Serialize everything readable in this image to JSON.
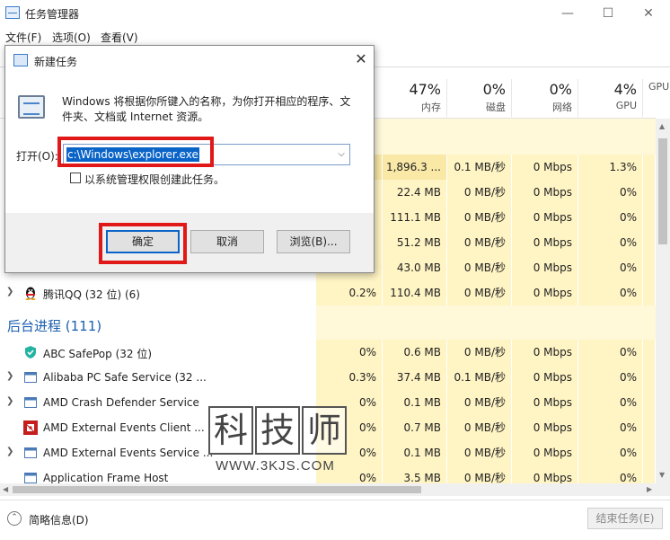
{
  "window": {
    "title": "任务管理器"
  },
  "menu": [
    "文件(F)",
    "选项(O)",
    "查看(V)"
  ],
  "columns": [
    {
      "pct": "47%",
      "label": "内存"
    },
    {
      "pct": "0%",
      "label": "磁盘"
    },
    {
      "pct": "0%",
      "label": "网络"
    },
    {
      "pct": "4%",
      "label": "GPU"
    },
    {
      "pct": "",
      "label": "GPU"
    }
  ],
  "app_rows": [
    {
      "cpu": "",
      "mem": "1,896.3 ...",
      "disk": "0.1 MB/秒",
      "net": "0 Mbps",
      "gpu": "1.3%"
    },
    {
      "cpu": "",
      "mem": "22.4 MB",
      "disk": "0 MB/秒",
      "net": "0 Mbps",
      "gpu": "0%"
    },
    {
      "cpu": "",
      "mem": "111.1 MB",
      "disk": "0 MB/秒",
      "net": "0 Mbps",
      "gpu": "0%"
    },
    {
      "cpu": "",
      "mem": "51.2 MB",
      "disk": "0 MB/秒",
      "net": "0 Mbps",
      "gpu": "0%"
    },
    {
      "cpu": "",
      "mem": "43.0 MB",
      "disk": "0 MB/秒",
      "net": "0 Mbps",
      "gpu": "0%"
    },
    {
      "name": "腾讯QQ (32 位) (6)",
      "cpu": "0.2%",
      "mem": "110.4 MB",
      "disk": "0 MB/秒",
      "net": "0 Mbps",
      "gpu": "0%"
    }
  ],
  "background_section": {
    "title": "后台进程 (111)"
  },
  "bg_rows": [
    {
      "name": "ABC SafePop (32 位)",
      "cpu": "0%",
      "mem": "0.6 MB",
      "disk": "0 MB/秒",
      "net": "0 Mbps",
      "gpu": "0%"
    },
    {
      "name": "Alibaba PC Safe Service (32 ...",
      "cpu": "0.3%",
      "mem": "37.4 MB",
      "disk": "0.1 MB/秒",
      "net": "0 Mbps",
      "gpu": "0%"
    },
    {
      "name": "AMD Crash Defender Service",
      "cpu": "0%",
      "mem": "0.1 MB",
      "disk": "0 MB/秒",
      "net": "0 Mbps",
      "gpu": "0%"
    },
    {
      "name": "AMD External Events Client ...",
      "cpu": "0%",
      "mem": "0.7 MB",
      "disk": "0 MB/秒",
      "net": "0 Mbps",
      "gpu": "0%"
    },
    {
      "name": "AMD External Events Service ...",
      "cpu": "0%",
      "mem": "0.1 MB",
      "disk": "0 MB/秒",
      "net": "0 Mbps",
      "gpu": "0%"
    },
    {
      "name": "Application Frame Host",
      "cpu": "0%",
      "mem": "3.5 MB",
      "disk": "0 MB/秒",
      "net": "0 Mbps",
      "gpu": "0%"
    }
  ],
  "statusbar": {
    "summary": "简略信息(D)",
    "end_task": "结束任务(E)"
  },
  "dialog": {
    "title": "新建任务",
    "description": "Windows 将根据你所键入的名称，为你打开相应的程序、文件夹、文档或 Internet 资源。",
    "open_label": "打开(O):",
    "input_value": "c:\\Windows\\explorer.exe",
    "admin_checkbox_label": "以系统管理权限创建此任务。",
    "ok": "确定",
    "cancel": "取消",
    "browse": "浏览(B)..."
  },
  "watermark": {
    "chars": [
      "科",
      "技",
      "师"
    ],
    "url": "WWW.3KJS.COM"
  },
  "colors": {
    "accent": "#1b5fb0",
    "highlight_cell": "#fff4c4",
    "annotation": "#e01818",
    "selection": "#0a64c8"
  }
}
